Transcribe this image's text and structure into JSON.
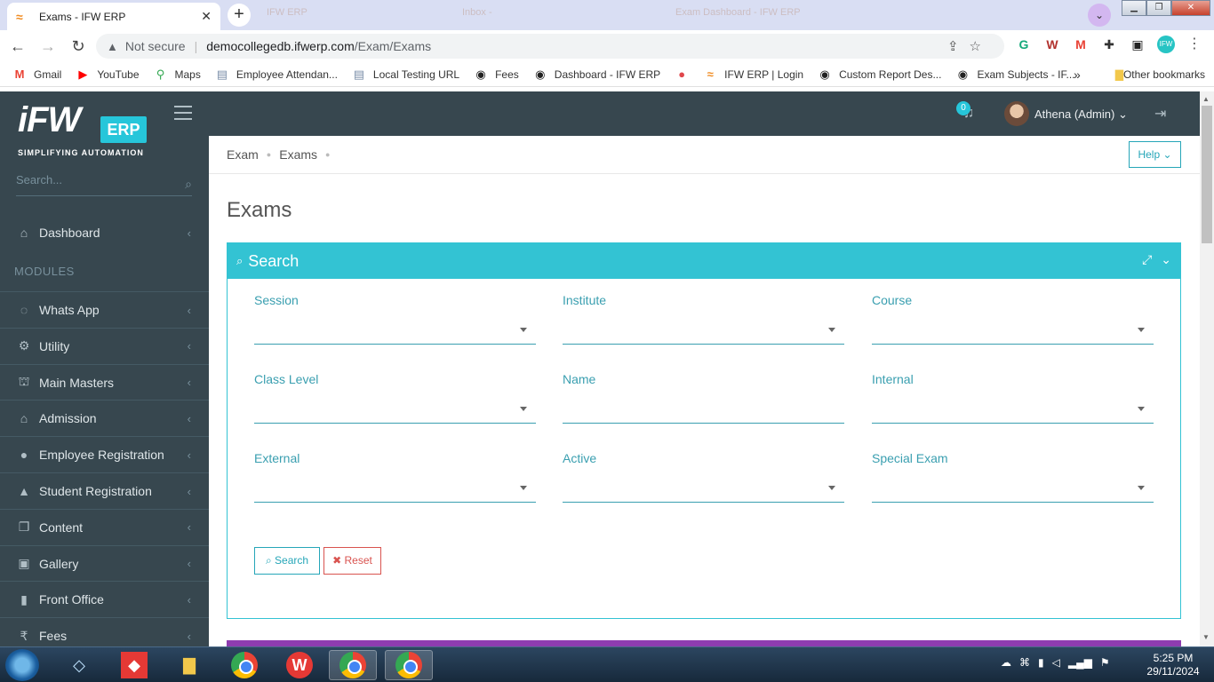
{
  "browser": {
    "active_tab_title": "Exams - IFW ERP",
    "ghost_tabs": [
      "IFW ERP",
      "Inbox - ",
      "Exam Dashboard - IFW ERP"
    ],
    "security_label": "Not secure",
    "url_host": "democollegedb.ifwerp.com",
    "url_path": "/Exam/Exams",
    "bookmarks": [
      {
        "label": "Gmail",
        "icon": "gmail-icon",
        "glyph": "M",
        "color": "#ea4335"
      },
      {
        "label": "YouTube",
        "icon": "youtube-icon",
        "glyph": "▶",
        "color": "#ff0000"
      },
      {
        "label": "Maps",
        "icon": "maps-icon",
        "glyph": "⚲",
        "color": "#34a853"
      },
      {
        "label": "Employee Attendan...",
        "icon": "doc-icon",
        "glyph": "▤",
        "color": "#7a8ea8"
      },
      {
        "label": "Local Testing URL",
        "icon": "doc-icon",
        "glyph": "▤",
        "color": "#7a8ea8"
      },
      {
        "label": "Fees",
        "icon": "globe-icon",
        "glyph": "◉",
        "color": "#222"
      },
      {
        "label": "Dashboard - IFW ERP",
        "icon": "globe-icon",
        "glyph": "◉",
        "color": "#222"
      },
      {
        "label": "",
        "icon": "red-circle-icon",
        "glyph": "●",
        "color": "#e0474c"
      },
      {
        "label": "IFW ERP | Login",
        "icon": "ifw-icon",
        "glyph": "≈",
        "color": "#f08c22"
      },
      {
        "label": "Custom Report Des...",
        "icon": "globe-icon",
        "glyph": "◉",
        "color": "#222"
      },
      {
        "label": "Exam Subjects - IF...",
        "icon": "globe-icon",
        "glyph": "◉",
        "color": "#222"
      }
    ],
    "other_bookmarks": "Other bookmarks"
  },
  "app": {
    "logo_text": "iFW",
    "logo_badge": "ERP",
    "logo_tagline": "SIMPLIFYING AUTOMATION",
    "sidebar_search_placeholder": "Search...",
    "dashboard_label": "Dashboard",
    "modules_label": "MODULES",
    "menu": [
      {
        "label": "Whats App",
        "icon": "whatsapp-icon",
        "glyph": "◌"
      },
      {
        "label": "Utility",
        "icon": "gears-icon",
        "glyph": "⚙"
      },
      {
        "label": "Main Masters",
        "icon": "sitemap-icon",
        "glyph": "⛫"
      },
      {
        "label": "Admission",
        "icon": "bank-icon",
        "glyph": "⌂"
      },
      {
        "label": "Employee Registration",
        "icon": "user-icon",
        "glyph": "●"
      },
      {
        "label": "Student Registration",
        "icon": "graduation-cap-icon",
        "glyph": "▲"
      },
      {
        "label": "Content",
        "icon": "copy-icon",
        "glyph": "❐"
      },
      {
        "label": "Gallery",
        "icon": "image-icon",
        "glyph": "▣"
      },
      {
        "label": "Front Office",
        "icon": "building-icon",
        "glyph": "▮"
      },
      {
        "label": "Fees",
        "icon": "rupee-icon",
        "glyph": "₹"
      }
    ],
    "notification_count": "0",
    "user_name": "Athena (Admin)"
  },
  "page": {
    "breadcrumb": [
      "Exam",
      "Exams"
    ],
    "help_label": "Help",
    "title": "Exams",
    "panel_title": "Search",
    "fields": {
      "session": "Session",
      "institute": "Institute",
      "course": "Course",
      "class_level": "Class Level",
      "name": "Name",
      "internal": "Internal",
      "external": "External",
      "active": "Active",
      "special_exam": "Special Exam"
    },
    "search_button": "Search",
    "reset_button": "Reset"
  },
  "taskbar": {
    "time": "5:25 PM",
    "date": "29/11/2024"
  }
}
